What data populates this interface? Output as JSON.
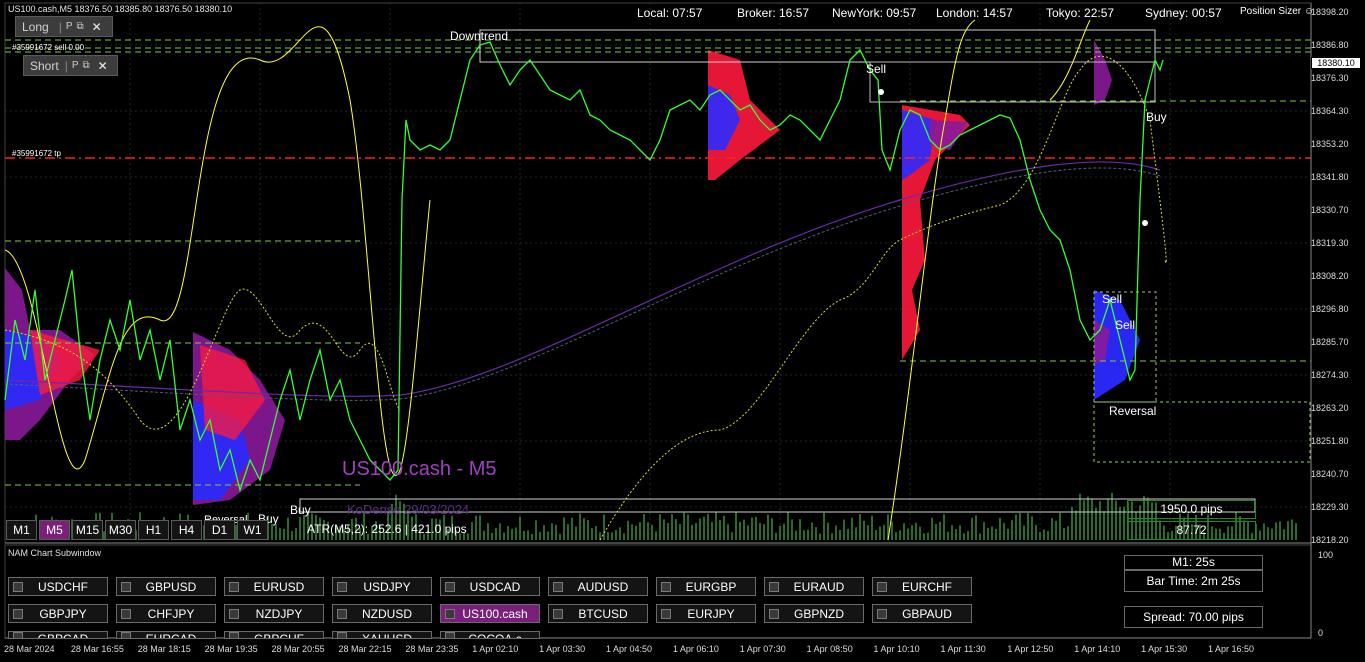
{
  "symbol_line": "US100.cash,M5  18376.50 18385.80 18376.50 18380.10",
  "long_panel": {
    "label": "Long",
    "p_label": "P",
    "close": "✕"
  },
  "short_panel": {
    "label": "Short",
    "p_label": "P",
    "close": "✕"
  },
  "order_labels": {
    "sell_order": "#35991672 sell 0.00",
    "tp_order": "#35991672 tp"
  },
  "clocks": [
    {
      "label": "Local: 07:57",
      "active": false
    },
    {
      "label": "Broker: 16:57",
      "active": false
    },
    {
      "label": "NewYork: 09:57",
      "active": true
    },
    {
      "label": "London: 14:57",
      "active": true
    },
    {
      "label": "Tokyo: 22:57",
      "active": false
    },
    {
      "label": "Sydney: 00:57",
      "active": false
    }
  ],
  "position_sizer": "Position Sizer ☺",
  "price_axis": [
    "18398.20",
    "18386.80",
    "18376.30",
    "18364.30",
    "18353.20",
    "18341.80",
    "18330.70",
    "18319.30",
    "18308.20",
    "18296.80",
    "18285.70",
    "18274.30",
    "18263.20",
    "18251.80",
    "18240.70",
    "18229.30",
    "18218.20"
  ],
  "current_price": "18380.10",
  "chart_labels": {
    "downtrend": "Downtrend",
    "sell_1": "Sell",
    "buy_1": "Buy",
    "sell_2": "Sell",
    "sell_3": "Sell",
    "reversal": "Reversal",
    "buy_bottom_1": "Buy",
    "buy_bottom_2": "Buy",
    "overlap": "Reversal"
  },
  "watermark": "US100.cash - M5",
  "watermark_date": "KoDense 29/03/2024",
  "timeframes": [
    {
      "label": "M1",
      "active": false
    },
    {
      "label": "M5",
      "active": true
    },
    {
      "label": "M15",
      "active": false
    },
    {
      "label": "M30",
      "active": false
    },
    {
      "label": "H1",
      "active": false
    },
    {
      "label": "H4",
      "active": false
    },
    {
      "label": "D1",
      "active": false
    },
    {
      "label": "W1",
      "active": false
    }
  ],
  "atr_text": "ATR(M5,2): 252.6  |  421.0 pips",
  "pips_value": "1950.0 pips",
  "ratio_value": "87.72",
  "subwindow_title": "NAM Chart Subwindow",
  "pairs_row1": [
    "USDCHF",
    "GBPUSD",
    "EURUSD",
    "USDJPY",
    "USDCAD",
    "AUDUSD",
    "EURGBP",
    "EURAUD",
    "EURCHF"
  ],
  "pairs_row2": [
    "GBPJPY",
    "CHFJPY",
    "NZDJPY",
    "NZDUSD",
    "US100.cash",
    "BTCUSD",
    "EURJPY",
    "GBPNZD",
    "GBPAUD"
  ],
  "pairs_row3": [
    "GBPCAD",
    "EURCAD",
    "GBPCHF",
    "XAUUSD",
    "COCOA.c"
  ],
  "active_pair": "US100.cash",
  "info": {
    "m1": "M1:  25s",
    "bar_time": "Bar Time: 2m 25s",
    "spread": "Spread: 70.00 pips"
  },
  "sub_axis": {
    "top": "100",
    "bottom": "0"
  },
  "time_axis": [
    "28 Mar 2024",
    "28 Mar 16:55",
    "28 Mar 18:15",
    "28 Mar 19:35",
    "28 Mar 20:55",
    "28 Mar 22:15",
    "28 Mar 23:35",
    "1 Apr 02:10",
    "1 Apr 03:30",
    "1 Apr 04:50",
    "1 Apr 06:10",
    "1 Apr 07:30",
    "1 Apr 08:50",
    "1 Apr 10:10",
    "1 Apr 11:30",
    "1 Apr 12:50",
    "1 Apr 14:10",
    "1 Apr 15:30",
    "1 Apr 16:50"
  ],
  "colors": {
    "candle_line": "#33ff33",
    "ma_yellow": "#ffff33",
    "profile_red": "#ff1a3c",
    "profile_blue": "#2a2aff",
    "profile_purple": "#8a1a9a",
    "active_button": "#7a1f7a",
    "tp_line": "#ff2020"
  }
}
